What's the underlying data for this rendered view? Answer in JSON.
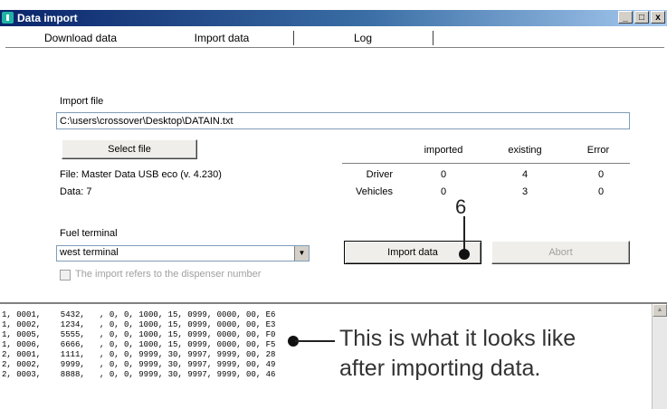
{
  "window": {
    "title": "Data import",
    "buttons": [
      "_",
      "□",
      "x"
    ]
  },
  "tabs": [
    "Download data",
    "Import data",
    "Log"
  ],
  "import_file": {
    "label": "Import file",
    "path": "C:\\users\\crossover\\Desktop\\DATAIN.txt"
  },
  "select_file_label": "Select file",
  "file_info": "File:  Master Data USB eco (v. 4.230)",
  "data_info": "Data:  7",
  "stats": {
    "headers": [
      "imported",
      "existing",
      "Error"
    ],
    "rows": [
      {
        "label": "Driver",
        "values": [
          "0",
          "4",
          "0"
        ]
      },
      {
        "label": "Vehicles",
        "values": [
          "0",
          "3",
          "0"
        ]
      }
    ]
  },
  "fuel_terminal": {
    "label": "Fuel terminal",
    "value": "west terminal"
  },
  "import_button": "Import data",
  "abort_button": "Abort",
  "checkbox_label": "The import refers to the dispenser number",
  "log_lines": [
    "1, 0001,    5432,   , 0, 0, 1000, 15, 0999, 0000, 00, E6",
    "1, 0002,    1234,   , 0, 0, 1000, 15, 0999, 0000, 00, E3",
    "1, 0005,    5555,   , 0, 0, 1000, 15, 0999, 0000, 00, F0",
    "1, 0006,    6666,   , 0, 0, 1000, 15, 0999, 0000, 00, F5",
    "2, 0001,    1111,   , 0, 0, 9999, 30, 9997, 9999, 00, 28",
    "2, 0002,    9999,   , 0, 0, 9999, 30, 9997, 9999, 00, 49",
    "2, 0003,    8888,   , 0, 0, 9999, 30, 9997, 9999, 00, 46"
  ],
  "annotation": {
    "number": "6",
    "text_line1": "This is what it looks like",
    "text_line2": "after importing data."
  }
}
